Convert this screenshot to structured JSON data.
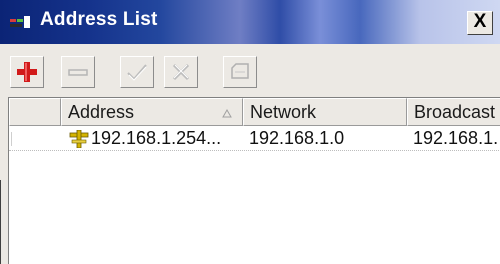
{
  "window": {
    "title": "Address List",
    "close_label": "X"
  },
  "toolbar": {
    "buttons": [
      {
        "name": "add",
        "icon": "plus-icon",
        "color": "#d11a1a"
      },
      {
        "name": "remove",
        "icon": "minus-icon",
        "color": "#b0b0b0"
      },
      {
        "name": "enable",
        "icon": "check-icon",
        "color": "#b0b0b0"
      },
      {
        "name": "disable",
        "icon": "x-icon",
        "color": "#b0b0b0"
      },
      {
        "name": "comment",
        "icon": "note-icon",
        "color": "#b0b0b0"
      }
    ]
  },
  "table": {
    "columns": [
      "Address",
      "Network",
      "Broadcast"
    ],
    "sort_column": "Address",
    "rows": [
      {
        "address": "192.168.1.254...",
        "network": "192.168.1.0",
        "broadcast": "192.168.1."
      }
    ]
  },
  "colors": {
    "title_text": "#ffffff",
    "row_icon": "#d4b400"
  }
}
